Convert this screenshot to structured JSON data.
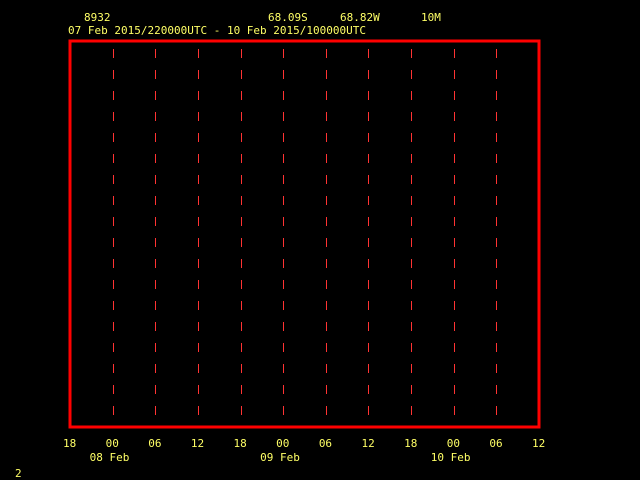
{
  "header": {
    "station_id": "8932",
    "latitude": "68.09S",
    "longitude": "68.82W",
    "height": "10M",
    "time_range": "07 Feb 2015/220000UTC - 10 Feb 2015/100000UTC"
  },
  "colors": {
    "frame": "#ff0000",
    "gridline": "#ff3333",
    "text": "#ffff66",
    "background": "#000000"
  },
  "chart_data": {
    "type": "line",
    "title": "",
    "xlabel": "",
    "ylabel": "",
    "x_tick_labels": [
      "18",
      "00",
      "06",
      "12",
      "18",
      "00",
      "06",
      "12",
      "18",
      "00",
      "06",
      "12"
    ],
    "x_date_labels": [
      "08 Feb",
      "09 Feb",
      "10 Feb"
    ],
    "grid": "vertical dashed",
    "series": []
  },
  "footer": {
    "page_number": "2"
  }
}
